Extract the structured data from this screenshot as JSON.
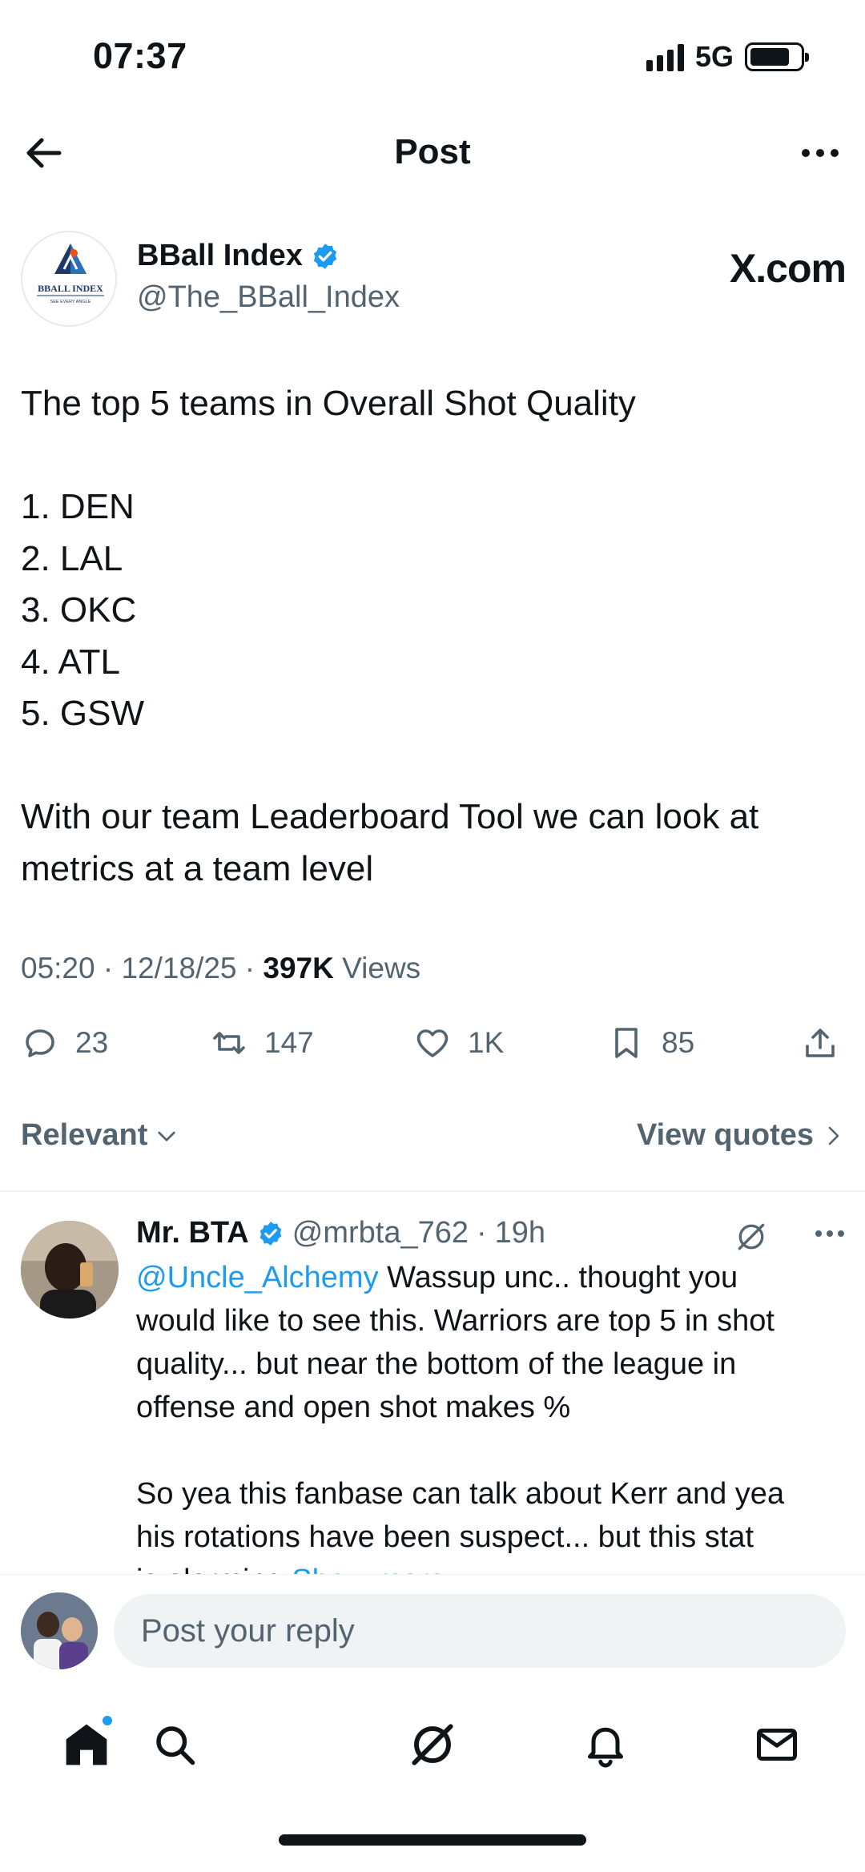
{
  "status_bar": {
    "time": "07:37",
    "network": "5G",
    "battery_level": 0.8
  },
  "header": {
    "title": "Post"
  },
  "author": {
    "name": "BBall Index",
    "handle": "@The_BBall_Index",
    "avatar_text": "BBALL INDEX",
    "avatar_tagline": "SEE EVERY ANGLE",
    "watermark": "X.com"
  },
  "post": {
    "lines": [
      "The top 5 teams in Overall Shot Quality",
      "",
      "1. DEN",
      "2. LAL",
      "3. OKC",
      "4. ATL",
      "5. GSW",
      "",
      "With our team Leaderboard Tool we can look at",
      "metrics at a team level"
    ],
    "time": "05:20",
    "date": "12/18/25",
    "views_count": "397K",
    "views_label": "Views"
  },
  "actions": {
    "replies": "23",
    "reposts": "147",
    "likes": "1K",
    "bookmarks": "85"
  },
  "sort": {
    "label": "Relevant",
    "quotes_label": "View quotes"
  },
  "reply": {
    "name": "Mr. BTA",
    "handle": "@mrbta_762",
    "time": "19h",
    "mention": "@Uncle_Alchemy",
    "line1_rest": " Wassup unc.. thought you",
    "lines": [
      "would like to see this. Warriors are top 5 in shot",
      "quality... but near the bottom of the league in",
      "offense and open shot makes %",
      "",
      "So yea this fanbase can talk about Kerr and yea",
      "his rotations have been suspect... but this stat"
    ],
    "last_line": "is alarming",
    "show_more": "Show more"
  },
  "composer": {
    "placeholder": "Post your reply"
  },
  "colors": {
    "accent": "#1d9bf0",
    "text": "#0f1419",
    "secondary": "#536471"
  }
}
